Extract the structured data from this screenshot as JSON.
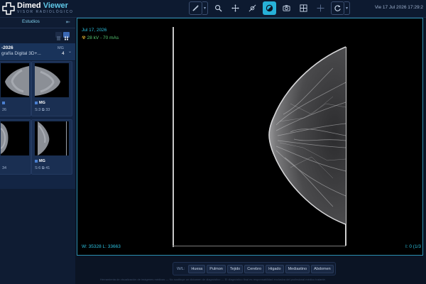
{
  "header": {
    "brand_main": "Dimed",
    "brand_accent": "Viewer",
    "brand_subtitle": "VISOR RADIOLÓGICO",
    "datetime": "Vie 17 Jul 2026 17:29:2"
  },
  "toolbar": {
    "tools": [
      "ruler-icon",
      "zoom-icon",
      "pan-icon",
      "window-level-icon",
      "invert-icon",
      "camera-icon",
      "layout-icon",
      "crosshair-icon",
      "reset-icon"
    ],
    "active_tool": "invert-icon"
  },
  "sidebar": {
    "tab_label": "Estudios",
    "study": {
      "date": "-2026",
      "description": "grafía Digital 3D+...",
      "modality": "MG",
      "count": "4"
    },
    "series": [
      {
        "modality": "",
        "info": "26"
      },
      {
        "modality": "MG",
        "info": "S:3  ⧉ 33"
      },
      {
        "modality": "",
        "info": "34"
      },
      {
        "modality": "MG",
        "info": "S:6  ⧉ 41"
      }
    ]
  },
  "viewport": {
    "date": "Jul 17, 2026",
    "exposure": "28 kV - 70 mAs",
    "window_level": "W:  35328   L:  33663",
    "image_index": "I: 0 (1/3"
  },
  "presets": {
    "label": "W/L:",
    "items": [
      "Huesa",
      "Pulmon",
      "Tejido",
      "Cerebro",
      "Higado",
      "Mediastino",
      "Abdomen"
    ]
  },
  "footer": {
    "text": "Herramienta de visualización de imágenes médicas — No sustituye un dictamen de diagnóstico — El diagnóstico final es responsabilidad exclusiva del profesional médico tratante."
  },
  "colors": {
    "accent": "#27b1d8",
    "background": "#0b1424",
    "overlay_text": "#2cc1e0",
    "exposure_text": "#56c873"
  }
}
